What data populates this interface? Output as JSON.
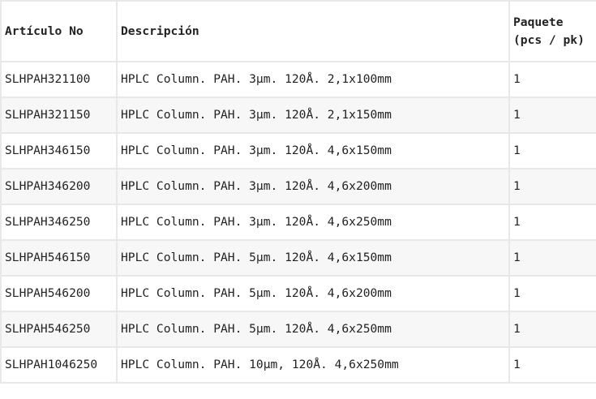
{
  "table": {
    "headers": [
      "Artículo No",
      "Descripción",
      "Paquete (pcs / pk)"
    ],
    "rows": [
      [
        "SLHPAH321100",
        "HPLC Column. PAH. 3µm. 120Å. 2,1x100mm",
        "1"
      ],
      [
        "SLHPAH321150",
        "HPLC Column. PAH. 3µm. 120Å. 2,1x150mm",
        "1"
      ],
      [
        "SLHPAH346150",
        "HPLC Column. PAH. 3µm. 120Å. 4,6x150mm",
        "1"
      ],
      [
        "SLHPAH346200",
        "HPLC Column. PAH. 3µm. 120Å. 4,6x200mm",
        "1"
      ],
      [
        "SLHPAH346250",
        "HPLC Column. PAH. 3µm. 120Å. 4,6x250mm",
        "1"
      ],
      [
        "SLHPAH546150",
        "HPLC Column. PAH. 5µm. 120Å. 4,6x150mm",
        "1"
      ],
      [
        "SLHPAH546200",
        "HPLC Column. PAH. 5µm. 120Å. 4,6x200mm",
        "1"
      ],
      [
        "SLHPAH546250",
        "HPLC Column. PAH. 5µm. 120Å. 4,6x250mm",
        "1"
      ],
      [
        "SLHPAH1046250",
        "HPLC Column. PAH. 10µm, 120Å. 4,6x250mm",
        "1"
      ]
    ]
  }
}
